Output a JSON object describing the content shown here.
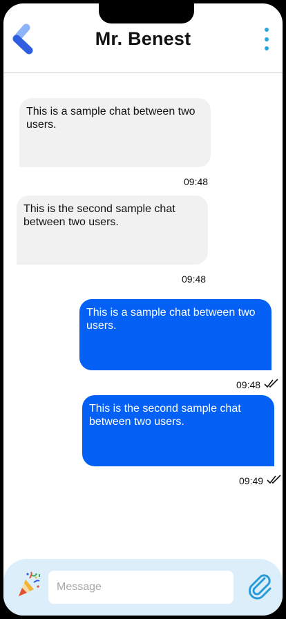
{
  "header": {
    "title": "Mr. Benest",
    "back_icon": "chevron-left-icon",
    "more_icon": "more-vertical-icon",
    "accent_color": "#29a8e0"
  },
  "messages": [
    {
      "direction": "incoming",
      "text": "This is a sample chat between two users.",
      "time": "09:48"
    },
    {
      "direction": "incoming",
      "text": "This is the second sample chat between two users.",
      "time": "09:48"
    },
    {
      "direction": "outgoing",
      "text": "This is a sample chat between two users.",
      "time": "09:48",
      "status_icon": "double-check-icon"
    },
    {
      "direction": "outgoing",
      "text": "This is the second sample chat between two users.",
      "time": "09:49",
      "status_icon": "double-check-icon"
    }
  ],
  "composer": {
    "emoji_icon": "party-popper-icon",
    "emoji": "🎉",
    "placeholder": "Message",
    "value": "",
    "attach_icon": "paperclip-icon"
  },
  "colors": {
    "incoming_bubble": "#f1f1f1",
    "outgoing_bubble": "#0560f5",
    "composer_bar": "#dbeefa"
  }
}
